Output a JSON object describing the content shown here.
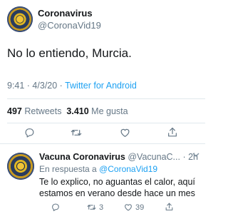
{
  "tweet": {
    "author_name": "Coronavirus",
    "author_handle": "@CoronaVid19",
    "text": "No lo entiendo, Murcia.",
    "time": "9:41 · 4/3/20 · ",
    "source": "Twitter for Android",
    "retweets": "497",
    "retweets_label": "Retweets",
    "likes": "3.410",
    "likes_label": "Me gusta"
  },
  "reply": {
    "author_name": "Vacuna Coronavirus",
    "author_handle": "@VacunaC...",
    "separator": " · ",
    "age": "2h",
    "in_reply_to_prefix": "En respuesta a ",
    "in_reply_to_handle": "@CoronaVid19",
    "text_line_1": "Te lo explico, no aguantas el calor, aquí",
    "text_line_2": "estamos en verano desde hace un mes",
    "retweet_count": "3",
    "like_count": "39"
  },
  "colors": {
    "link": "#1da1f2",
    "secondary": "#657786",
    "divider": "#e1e8ed"
  },
  "icons": [
    "reply-icon",
    "retweet-icon",
    "like-icon",
    "share-icon",
    "chevron-down-icon"
  ]
}
